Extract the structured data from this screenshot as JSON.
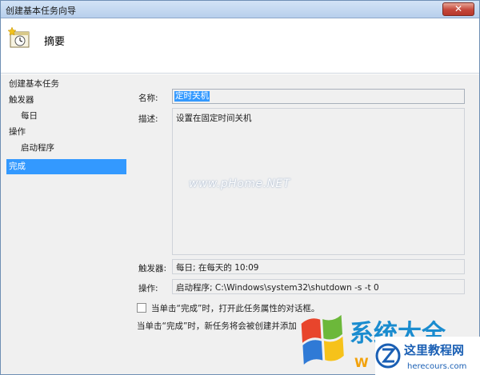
{
  "window": {
    "title": "创建基本任务向导",
    "close_label": "✕"
  },
  "header": {
    "icon": "task-clock-icon",
    "title": "摘要"
  },
  "nav": {
    "items": [
      {
        "label": "创建基本任务"
      },
      {
        "label": "触发器"
      },
      {
        "label": "每日"
      },
      {
        "label": "操作"
      },
      {
        "label": "启动程序"
      },
      {
        "label": "完成",
        "selected": true
      }
    ]
  },
  "form": {
    "name_label": "名称:",
    "name_value": "定时关机",
    "desc_label": "描述:",
    "desc_value": "设置在固定时间关机",
    "trigger_label": "触发器:",
    "trigger_value": "每日; 在每天的 10:09",
    "action_label": "操作:",
    "action_value": "启动程序; C:\\Windows\\system32\\shutdown -s -t 0"
  },
  "checkbox": {
    "label": "当单击“完成”时，打开此任务属性的对话框。",
    "checked": false
  },
  "bottom_note": "当单击“完成”时，新任务将会被创建并添加",
  "watermark": "www.pHome.NET",
  "logos": {
    "left_text": "系统大全",
    "left_small": "W",
    "right_title": "这里教程网",
    "right_url": "herecours.com"
  },
  "colors": {
    "selection": "#3399ff",
    "titlebar": "#c4d8f0",
    "close": "#c4473a"
  }
}
